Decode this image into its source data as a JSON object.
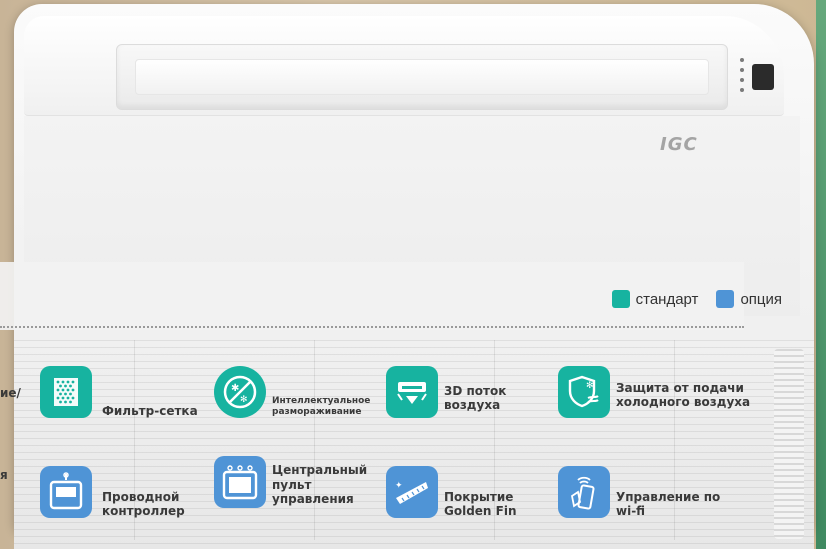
{
  "brand": {
    "logo_text": "IGC"
  },
  "legend": {
    "standard": {
      "label": "стандарт",
      "color": "#17b3a0"
    },
    "option": {
      "label": "опция",
      "color": "#4f94d6"
    }
  },
  "edge_fragments": {
    "top": "ие/",
    "bottom": "я"
  },
  "features": [
    {
      "label": "Фильтр-сетка",
      "icon": "filter-mesh-icon",
      "color": "#17b3a0"
    },
    {
      "label": "Интеллектуальное размораживание",
      "icon": "defrost-icon",
      "color": "#17b3a0"
    },
    {
      "label": "3D поток воздуха",
      "icon": "airflow-3d-icon",
      "color": "#17b3a0"
    },
    {
      "label": "Защита от подачи холодного воздуха",
      "icon": "cold-air-shield-icon",
      "color": "#17b3a0"
    },
    {
      "label": "Проводной контроллер",
      "icon": "wired-controller-icon",
      "color": "#4f94d6"
    },
    {
      "label": "Центральный пульт управления",
      "icon": "central-control-icon",
      "color": "#4f94d6"
    },
    {
      "label": "Покрытие Golden Fin",
      "icon": "golden-fin-icon",
      "color": "#4f94d6"
    },
    {
      "label": "Управление по wi-fi",
      "icon": "wifi-remote-icon",
      "color": "#4f94d6"
    }
  ]
}
